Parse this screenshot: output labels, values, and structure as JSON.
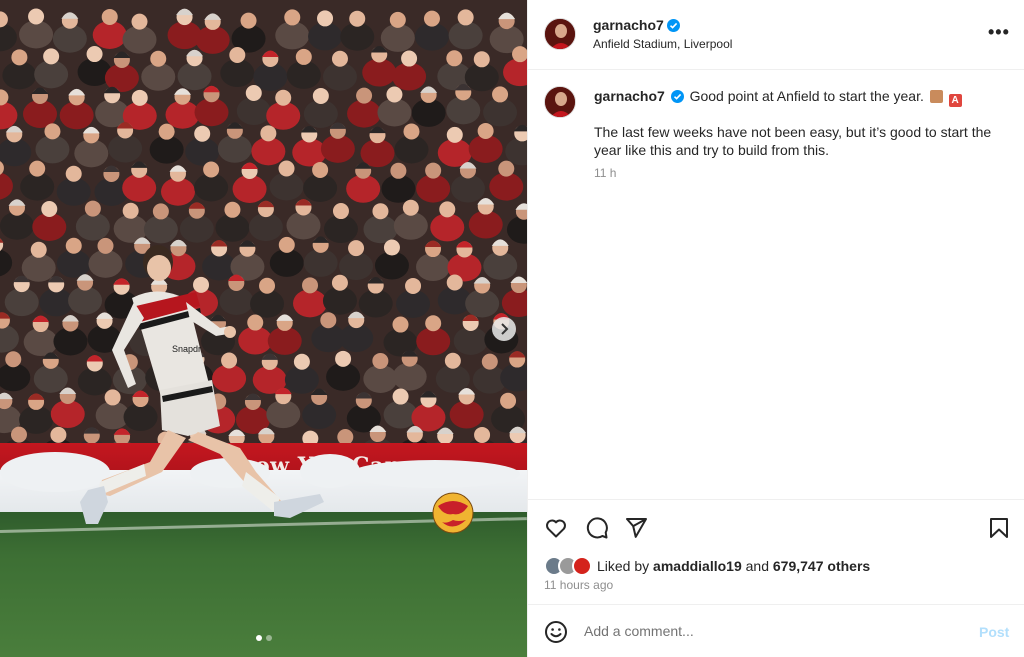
{
  "post": {
    "username": "garnacho7",
    "location": "Anfield Stadium, Liverpool",
    "more_icon": "more-horizontal-icon"
  },
  "media": {
    "ad_board_text": "ow You Can",
    "shirt_sponsor": "Snapdr",
    "carousel_count": 2,
    "carousel_active_index": 0,
    "next_icon": "chevron-right-icon"
  },
  "caption": {
    "username": "garnacho7",
    "headline": "Good point at Anfield to start the year.",
    "emojis": [
      "flexed-biceps",
      "letter-a-button"
    ],
    "body": "The last few weeks have not been easy, but it’s good to start the year like this and try to build from this.",
    "time": "11 h"
  },
  "actions": {
    "icons": [
      "heart-icon",
      "comment-icon",
      "share-icon",
      "bookmark-icon"
    ]
  },
  "likes": {
    "prefix": "Liked by",
    "user": "amaddiallo19",
    "joiner": "and",
    "others": "679,747 others"
  },
  "timestamp": "11 hours ago",
  "comment": {
    "placeholder": "Add a comment...",
    "post_label": "Post"
  },
  "colors": {
    "verified": "#0095f6",
    "post_disabled": "#b2dffc",
    "secondary_text": "#8e8e8e",
    "ad_board_red": "#c4171f"
  }
}
